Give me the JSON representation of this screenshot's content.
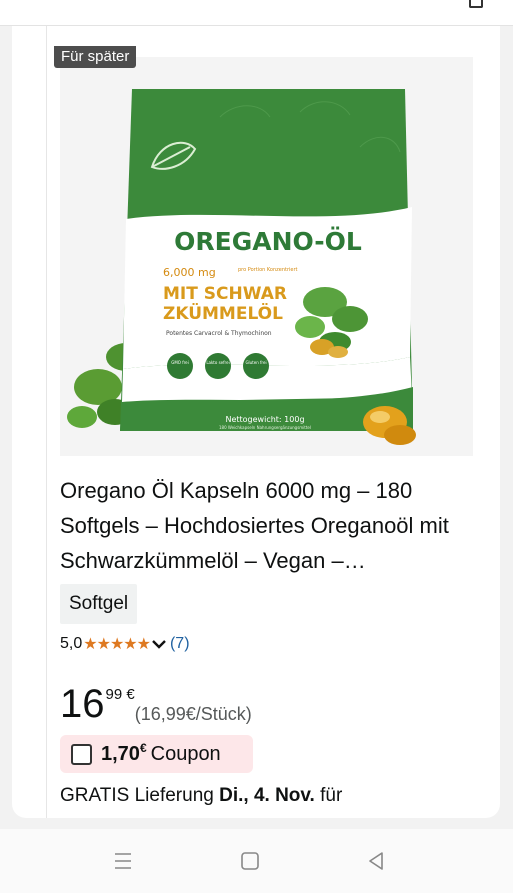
{
  "badge": {
    "label": "Für später"
  },
  "product": {
    "image_text": {
      "name": "OREGANO-ÖL",
      "dose": "6,000 mg",
      "dose_note": "pro Portion Konzentriert",
      "line1": "MIT SCHWAR",
      "line2": "ZKÜMMELÖL",
      "sub": "Potentes Carvacrol & Thymochinon",
      "badge1": "GMO frei",
      "badge2": "Lakto sefrei",
      "badge3": "Gluten frei",
      "weight": "Nettogewicht: 100g",
      "weight_sub": "180 Weichkapseln Nahrungsergänzungsmittel"
    },
    "title": "Oregano Öl Kapseln 6000 mg – 180 Softgels – Hochdosiertes Oreganoöl mit Schwarzkümmelöl – Vegan –…",
    "variant": "Softgel",
    "rating": {
      "value": "5,0",
      "stars": "★★★★★",
      "count": "(7)"
    },
    "price": {
      "whole": "16",
      "fraction": "99 €",
      "unit": "(16,99€/Stück)"
    },
    "coupon": {
      "amount": "1,70",
      "currency": "€",
      "label": "Coupon"
    },
    "delivery": {
      "prefix": "GRATIS Lieferung ",
      "date": "Di., 4. Nov.",
      "suffix": " für"
    }
  },
  "colors": {
    "star": "#de7921",
    "link": "#2162a1",
    "coupon_bg": "#fde7e9",
    "pack_green": "#3f8a3a"
  },
  "nav": {
    "icons": [
      "menu-icon",
      "home-square-icon",
      "back-triangle-icon"
    ]
  }
}
